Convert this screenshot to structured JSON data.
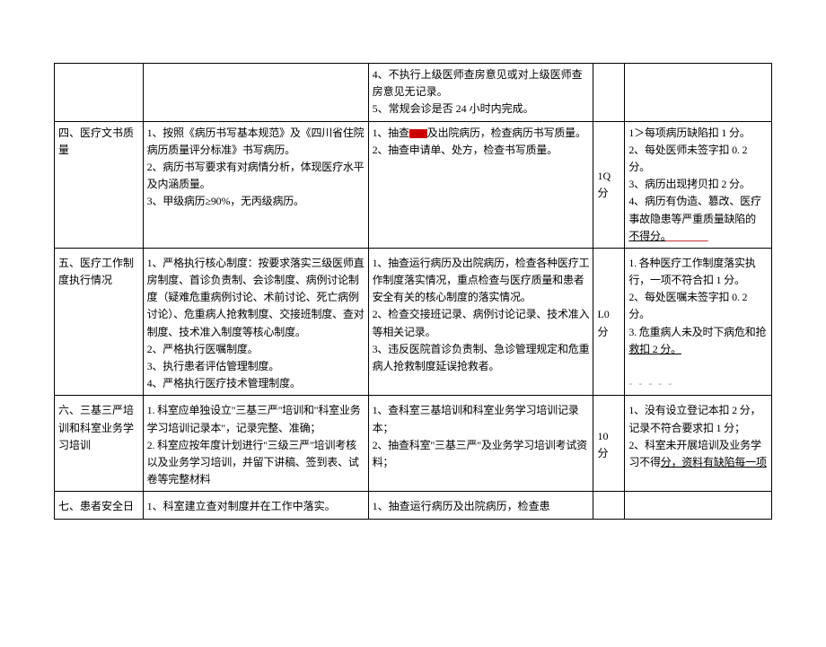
{
  "rows": {
    "r0": {
      "c1": "",
      "c2": "",
      "c3": "4、不执行上级医师查房意见或对上级医师查房意见无记录。\n5、常规会诊是否 24 小时内完成。",
      "c4": "",
      "c5": ""
    },
    "r1": {
      "c1": "四、医疗文书质量",
      "c2": "1、按照《病历书写基本规范》及《四川省住院病历质量评分标准》书写病历。\n2、病历书写要求有对病情分析，体现医疗水平及内涵质量。\n3、甲级病历≥90%，无丙级病历。",
      "c3a": "1、抽查",
      "c3b": "及出院病历，检查病历书写质量。\n2、抽查申请单、处方，检查书写质量。",
      "c4": "1Q 分",
      "c5a": "1＞每项病历缺陷扣 1 分。\n2、每处医师未签字扣 0. 2 分。\n3、病历出现拷贝扣 2 分。\n4、病历有伪造、篡改、医疗事故隐患等严重质量缺陷的",
      "c5b": "不得分。"
    },
    "r2": {
      "c1": "五、医疗工作制度执行情况",
      "c2": "1、严格执行核心制度：按要求落实三级医师直房制度、首诊负责制、会诊制度、病例讨论制度（疑难危重病例讨论、术前讨论、死亡病例讨论）、危重病人抢救制度、交接班制度、查对制度、技术准入制度等核心制度。\n2、严格执行医嘱制度。\n3、执行患者评估管理制度。\n4、严格执行医疗技术管理制度。",
      "c3": "1、抽查运行病历及出院病历，检查各种医疗工作制度落实情况，重点检查与医疗质量和患者安全有关的核心制度的落实情况。\n2、检查交接班记录、病例讨论记录、技术准入等相关记录。\n3、违反医院首诊负责制、急诊管理规定和危重病人抢救制度延误抢救者。",
      "c4": "L0 分",
      "c5a": "1. 各种医疗工作制度落实执行，一项不符合扣 1 分。\n2、每处医嘱未签字扣 0. 2 分。\n3. 危重病人未及时下病危和抢",
      "c5b": "救扣 2 分。",
      "c5c": "- - - - -"
    },
    "r3": {
      "c1": "六、三基三严培训和科室业务学习培训",
      "c2": "1. 科室应单独设立\"三基三严\"培训和\"科室业务学习培训记录本\"，记录完整、准确；\n2. 科室应按年度计划进行\"三级三严\"培训考核以及业务学习培训，并留下讲稿、签到表、试卷等完整材料",
      "c3": "1、查科室三基培训和科室业务学习培训记录本；\n2、抽查科室\"三基三严\"及业务学习培训考试资料；",
      "c4": "10 分",
      "c5a": "1、没有设立登记本扣 2 分，记录不符合要求扣 1 分；\n2、科室未开展培训及业务学习不得",
      "c5b": "分，资料有缺陷每一项"
    },
    "r4": {
      "c1": "七、患者安全日",
      "c2": "1、科室建立查对制度并在工作中落实。",
      "c3": "1、抽查运行病历及出院病历，检查患",
      "c4": "",
      "c5": ""
    }
  }
}
